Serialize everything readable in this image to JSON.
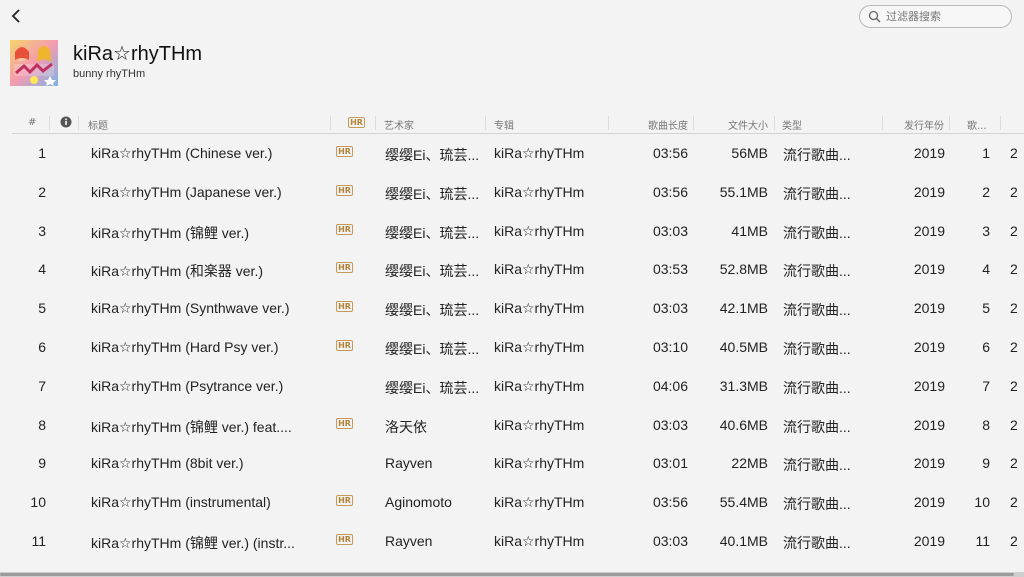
{
  "nav": {
    "back_icon": "chevron-left-icon"
  },
  "search": {
    "placeholder": "过滤器搜索",
    "value": "",
    "icon": "search-icon"
  },
  "album": {
    "title": "kiRa☆rhyTHm",
    "artist": "bunny rhyTHm"
  },
  "columns": {
    "num": "#",
    "info_icon": "info-icon",
    "title": "标题",
    "hr": "HR",
    "artist": "艺术家",
    "album": "专辑",
    "length": "歌曲长度",
    "size": "文件大小",
    "genre": "类型",
    "year": "发行年份",
    "track": "歌..."
  },
  "hr_badge": "HR",
  "tracks": [
    {
      "num": "1",
      "title": "kiRa☆rhyTHm (Chinese ver.)",
      "hr": true,
      "artist": "缨缨Ei、琉芸...",
      "album": "kiRa☆rhyTHm",
      "length": "03:56",
      "size": "56MB",
      "genre": "流行歌曲...",
      "year": "2019",
      "track": "1",
      "extra": "2"
    },
    {
      "num": "2",
      "title": "kiRa☆rhyTHm (Japanese ver.)",
      "hr": true,
      "artist": "缨缨Ei、琉芸...",
      "album": "kiRa☆rhyTHm",
      "length": "03:56",
      "size": "55.1MB",
      "genre": "流行歌曲...",
      "year": "2019",
      "track": "2",
      "extra": "2"
    },
    {
      "num": "3",
      "title": "kiRa☆rhyTHm (锦鲤 ver.)",
      "hr": true,
      "artist": "缨缨Ei、琉芸...",
      "album": "kiRa☆rhyTHm",
      "length": "03:03",
      "size": "41MB",
      "genre": "流行歌曲...",
      "year": "2019",
      "track": "3",
      "extra": "2"
    },
    {
      "num": "4",
      "title": "kiRa☆rhyTHm (和楽器 ver.)",
      "hr": true,
      "artist": "缨缨Ei、琉芸...",
      "album": "kiRa☆rhyTHm",
      "length": "03:53",
      "size": "52.8MB",
      "genre": "流行歌曲...",
      "year": "2019",
      "track": "4",
      "extra": "2"
    },
    {
      "num": "5",
      "title": "kiRa☆rhyTHm (Synthwave ver.)",
      "hr": true,
      "artist": "缨缨Ei、琉芸...",
      "album": "kiRa☆rhyTHm",
      "length": "03:03",
      "size": "42.1MB",
      "genre": "流行歌曲...",
      "year": "2019",
      "track": "5",
      "extra": "2"
    },
    {
      "num": "6",
      "title": "kiRa☆rhyTHm (Hard Psy ver.)",
      "hr": true,
      "artist": "缨缨Ei、琉芸...",
      "album": "kiRa☆rhyTHm",
      "length": "03:10",
      "size": "40.5MB",
      "genre": "流行歌曲...",
      "year": "2019",
      "track": "6",
      "extra": "2"
    },
    {
      "num": "7",
      "title": "kiRa☆rhyTHm (Psytrance ver.)",
      "hr": false,
      "artist": "缨缨Ei、琉芸...",
      "album": "kiRa☆rhyTHm",
      "length": "04:06",
      "size": "31.3MB",
      "genre": "流行歌曲...",
      "year": "2019",
      "track": "7",
      "extra": "2"
    },
    {
      "num": "8",
      "title": "kiRa☆rhyTHm (锦鲤 ver.) feat....",
      "hr": true,
      "artist": "洛天依",
      "album": "kiRa☆rhyTHm",
      "length": "03:03",
      "size": "40.6MB",
      "genre": "流行歌曲...",
      "year": "2019",
      "track": "8",
      "extra": "2"
    },
    {
      "num": "9",
      "title": "kiRa☆rhyTHm (8bit ver.)",
      "hr": false,
      "artist": "Rayven",
      "album": "kiRa☆rhyTHm",
      "length": "03:01",
      "size": "22MB",
      "genre": "流行歌曲...",
      "year": "2019",
      "track": "9",
      "extra": "2"
    },
    {
      "num": "10",
      "title": "kiRa☆rhyTHm (instrumental)",
      "hr": true,
      "artist": "Aginomoto",
      "album": "kiRa☆rhyTHm",
      "length": "03:56",
      "size": "55.4MB",
      "genre": "流行歌曲...",
      "year": "2019",
      "track": "10",
      "extra": "2"
    },
    {
      "num": "11",
      "title": "kiRa☆rhyTHm (锦鲤 ver.) (instr...",
      "hr": true,
      "artist": "Rayven",
      "album": "kiRa☆rhyTHm",
      "length": "03:03",
      "size": "40.1MB",
      "genre": "流行歌曲...",
      "year": "2019",
      "track": "11",
      "extra": "2"
    }
  ]
}
